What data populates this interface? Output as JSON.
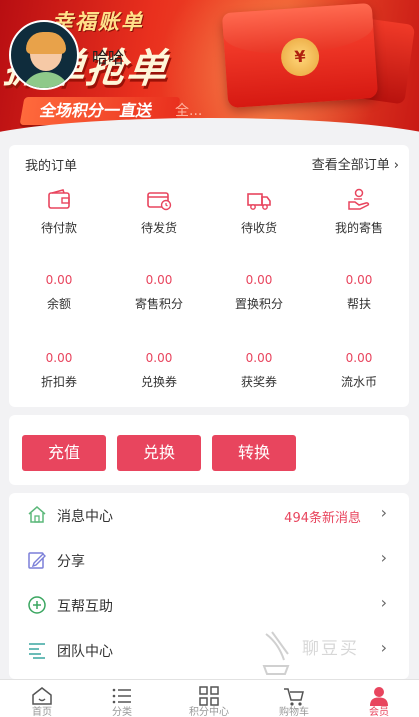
{
  "banner": {
    "brand": "幸福账单",
    "headline": "抓单抢单",
    "slogan": "全场积分一直送",
    "slogan_extra": "全...",
    "envelope_seal": "¥"
  },
  "user": {
    "name": "哈哈"
  },
  "orders": {
    "title": "我的订单",
    "view_all": "查看全部订单",
    "status_items": [
      {
        "label": "待付款",
        "icon": "wallet-icon"
      },
      {
        "label": "待发货",
        "icon": "shipping-box-icon"
      },
      {
        "label": "待收货",
        "icon": "truck-icon"
      },
      {
        "label": "我的寄售",
        "icon": "consign-hand-icon"
      }
    ],
    "stats_row1": [
      {
        "value": "0.00",
        "label": "余额"
      },
      {
        "value": "0.00",
        "label": "寄售积分"
      },
      {
        "value": "0.00",
        "label": "置换积分"
      },
      {
        "value": "0.00",
        "label": "帮扶"
      }
    ],
    "stats_row2": [
      {
        "value": "0.00",
        "label": "折扣券"
      },
      {
        "value": "0.00",
        "label": "兑换券"
      },
      {
        "value": "0.00",
        "label": "获奖券"
      },
      {
        "value": "0.00",
        "label": "流水币"
      }
    ]
  },
  "actions": {
    "recharge": "充值",
    "exchange": "兑换",
    "convert": "转换"
  },
  "menu": [
    {
      "label": "消息中心",
      "value": "494条新消息",
      "icon": "home-icon"
    },
    {
      "label": "分享",
      "value": "",
      "icon": "edit-icon"
    },
    {
      "label": "互帮互助",
      "value": "",
      "icon": "plus-circle-icon"
    },
    {
      "label": "团队中心",
      "value": "",
      "icon": "list-icon"
    }
  ],
  "watermark": "聊豆买",
  "tabbar": [
    {
      "label": "首页",
      "icon": "home-tab-icon"
    },
    {
      "label": "分类",
      "icon": "menu-list-icon"
    },
    {
      "label": "积分中心",
      "icon": "grid-icon"
    },
    {
      "label": "购物车",
      "icon": "cart-icon"
    },
    {
      "label": "会员",
      "icon": "user-icon"
    }
  ],
  "colors": {
    "accent": "#e8455e",
    "banner_red": "#e9301e",
    "background": "#f2f2f4"
  }
}
